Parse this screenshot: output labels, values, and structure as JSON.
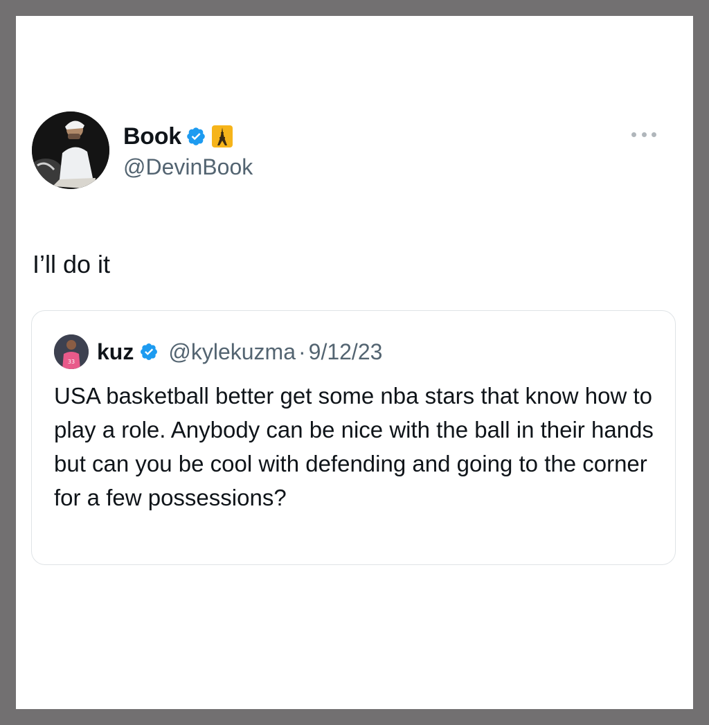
{
  "tweet": {
    "author": {
      "display_name": "Book",
      "handle": "@DevinBook",
      "verified": true,
      "badge_emoji": "eiffel-tower-emoji-icon"
    },
    "text": "I’ll do it",
    "more_icon": "more-horizontal-icon"
  },
  "quoted_tweet": {
    "author": {
      "display_name": "kuz",
      "handle": "@kylekuzma",
      "verified": true
    },
    "separator": "·",
    "date": "9/12/23",
    "text": "USA basketball better get some nba stars that know how to play a role. Anybody can be nice with the ball in their hands but can you be cool with defending and going to the corner for a few possessions?"
  },
  "colors": {
    "frame": "#727071",
    "text_primary": "#0f1419",
    "text_secondary": "#536471",
    "verified_blue": "#1d9bf0",
    "border": "#dfe3e6"
  }
}
